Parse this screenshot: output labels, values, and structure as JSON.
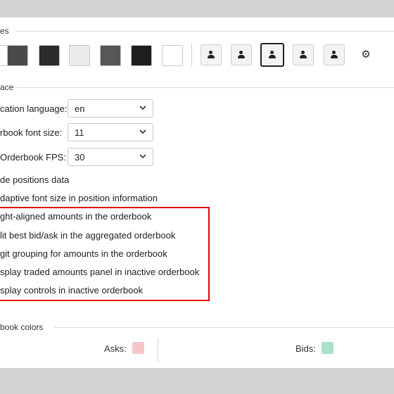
{
  "sections": {
    "themes_title": "es",
    "interface_title": "ace",
    "orderbook_colors_title": "book colors"
  },
  "themes": {
    "swatches": [
      {
        "name": "dark-gray",
        "color": "#4a4a4a"
      },
      {
        "name": "charcoal",
        "color": "#2b2b2b"
      },
      {
        "name": "light-gray",
        "color": "#ebebeb"
      },
      {
        "name": "medium-gray",
        "color": "#575757"
      },
      {
        "name": "black",
        "color": "#1e1e1e"
      },
      {
        "name": "white",
        "color": "#ffffff"
      }
    ],
    "layouts": [
      "person-icon",
      "person-icon",
      "person-icon",
      "person-icon",
      "person-icon"
    ],
    "selected_layout_index": 2,
    "settings_icon": "gear-icon"
  },
  "interface": {
    "language_label": "cation language:",
    "language_value": "en",
    "font_size_label": "rbook font size:",
    "font_size_value": "11",
    "fps_label": "Orderbook FPS:",
    "fps_value": "30",
    "options": [
      "de positions data",
      "daptive font size in position information",
      "ght-aligned amounts in the orderbook",
      "lit best bid/ask in the aggregated orderbook",
      "git grouping for amounts in the orderbook",
      "splay traded amounts panel in inactive orderbook",
      "splay controls in inactive orderbook"
    ]
  },
  "orderbook_colors": {
    "asks_label": "Asks:",
    "asks_color": "#f5c6c8",
    "bids_label": "Bids:",
    "bids_color": "#a8e2cb"
  },
  "highlight_color": "#e0000a"
}
